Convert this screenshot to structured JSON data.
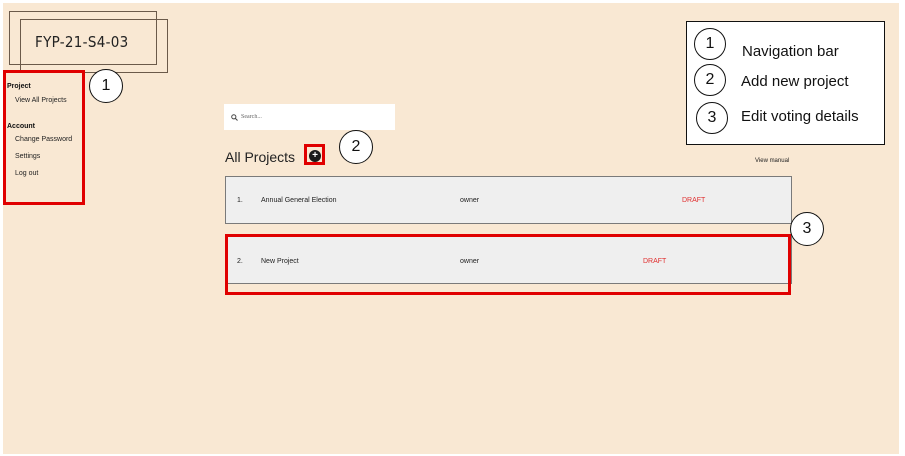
{
  "app": {
    "logo_text": "FYP-21-S4-03"
  },
  "sidebar": {
    "sections": [
      {
        "heading": "Project",
        "items": [
          "View All Projects"
        ]
      },
      {
        "heading": "Account",
        "items": [
          "Change Password",
          "Settings",
          "Log out"
        ]
      }
    ]
  },
  "search": {
    "placeholder": "Search..."
  },
  "main": {
    "title": "All Projects",
    "add_icon": "plus-circle-icon",
    "view_manual": "View manual",
    "projects": [
      {
        "index": "1.",
        "name": "Annual General Election",
        "role": "owner",
        "status": "DRAFT"
      },
      {
        "index": "2.",
        "name": "New Project",
        "role": "owner",
        "status": "DRAFT"
      }
    ]
  },
  "annotations": {
    "markers": [
      "1",
      "2",
      "3"
    ],
    "legend": [
      {
        "number": "1",
        "label": "Navigation bar"
      },
      {
        "number": "2",
        "label": "Add new project"
      },
      {
        "number": "3",
        "label": "Edit voting details"
      }
    ]
  },
  "colors": {
    "background": "#f9e8d3",
    "annotation_red": "#e00000",
    "status_red": "#e03030",
    "row_bg": "#efefef"
  }
}
